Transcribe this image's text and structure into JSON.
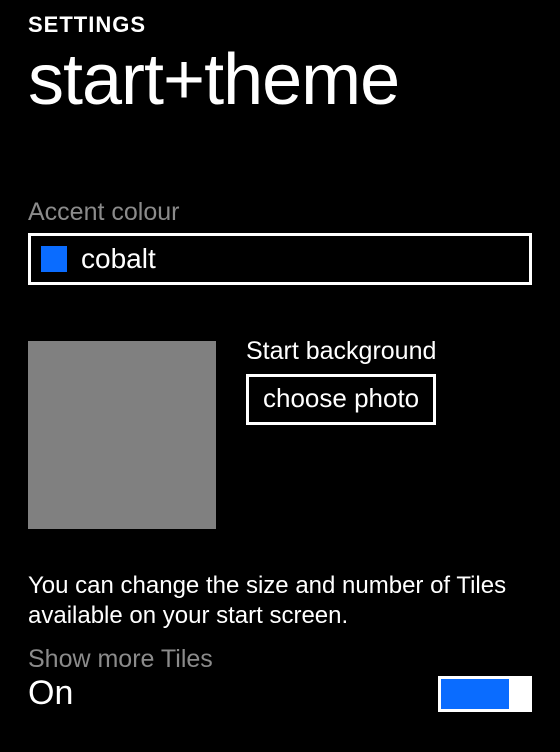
{
  "breadcrumb": "SETTINGS",
  "title": "start+theme",
  "accent": {
    "label": "Accent colour",
    "color": "#0a6cff",
    "name": "cobalt"
  },
  "startBackground": {
    "label": "Start background",
    "button": "choose photo"
  },
  "tiles": {
    "description": "You can change the size and number of Tiles available on your start screen.",
    "toggleLabel": "Show more Tiles",
    "toggleState": "On",
    "toggleOn": true
  }
}
